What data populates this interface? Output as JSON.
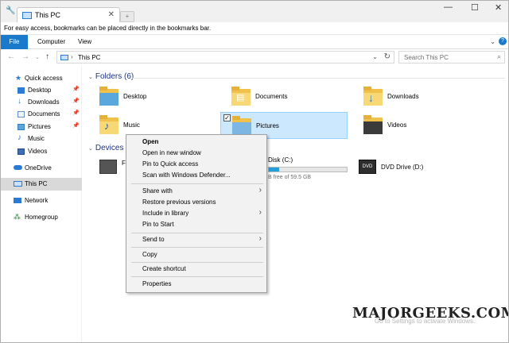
{
  "window": {
    "tab_title": "This PC",
    "new_tab_glyph": "+",
    "minimize": "—",
    "maximize": "☐",
    "close": "✕"
  },
  "bookmarks_bar": {
    "text": "For easy access, bookmarks can be placed directly in the bookmarks bar."
  },
  "ribbon": {
    "tabs": [
      "File",
      "Computer",
      "View"
    ]
  },
  "address": {
    "path": "This PC",
    "search_placeholder": "Search This PC"
  },
  "sidebar": {
    "items": [
      {
        "label": "Quick access",
        "icon": "star-icon"
      },
      {
        "label": "Desktop",
        "icon": "desktop-icon",
        "pinned": true
      },
      {
        "label": "Downloads",
        "icon": "downloads-icon",
        "pinned": true
      },
      {
        "label": "Documents",
        "icon": "documents-icon",
        "pinned": true
      },
      {
        "label": "Pictures",
        "icon": "pictures-icon",
        "pinned": true
      },
      {
        "label": "Music",
        "icon": "music-icon"
      },
      {
        "label": "Videos",
        "icon": "videos-icon"
      },
      {
        "label": "OneDrive",
        "icon": "cloud-icon"
      },
      {
        "label": "This PC",
        "icon": "computer-icon",
        "selected": true
      },
      {
        "label": "Network",
        "icon": "network-icon"
      },
      {
        "label": "Homegroup",
        "icon": "homegroup-icon"
      }
    ]
  },
  "folders_group": {
    "title": "Folders (6)",
    "items": [
      "Desktop",
      "Documents",
      "Downloads",
      "Music",
      "Pictures",
      "Videos"
    ]
  },
  "devices_group": {
    "title": "Devices a",
    "floppy_partial": "Fl",
    "local_disk_name": "Disk (C:)",
    "local_disk_free": "B free of 59.5 GB",
    "local_disk_used_fraction": 0.13,
    "dvd_name": "DVD Drive (D:)"
  },
  "context_menu": {
    "items": [
      {
        "label": "Open",
        "bold": true
      },
      {
        "label": "Open in new window"
      },
      {
        "label": "Pin to Quick access"
      },
      {
        "label": "Scan with Windows Defender..."
      },
      {
        "label": "Share with",
        "submenu": true
      },
      {
        "label": "Restore previous versions"
      },
      {
        "label": "Include in library",
        "submenu": true
      },
      {
        "label": "Pin to Start"
      },
      {
        "label": "Send to",
        "submenu": true
      },
      {
        "label": "Copy"
      },
      {
        "label": "Create shortcut"
      },
      {
        "label": "Properties"
      }
    ]
  },
  "watermark": "MAJORGEEKS.COM",
  "activation_text": "Go to Settings to activate Windows."
}
